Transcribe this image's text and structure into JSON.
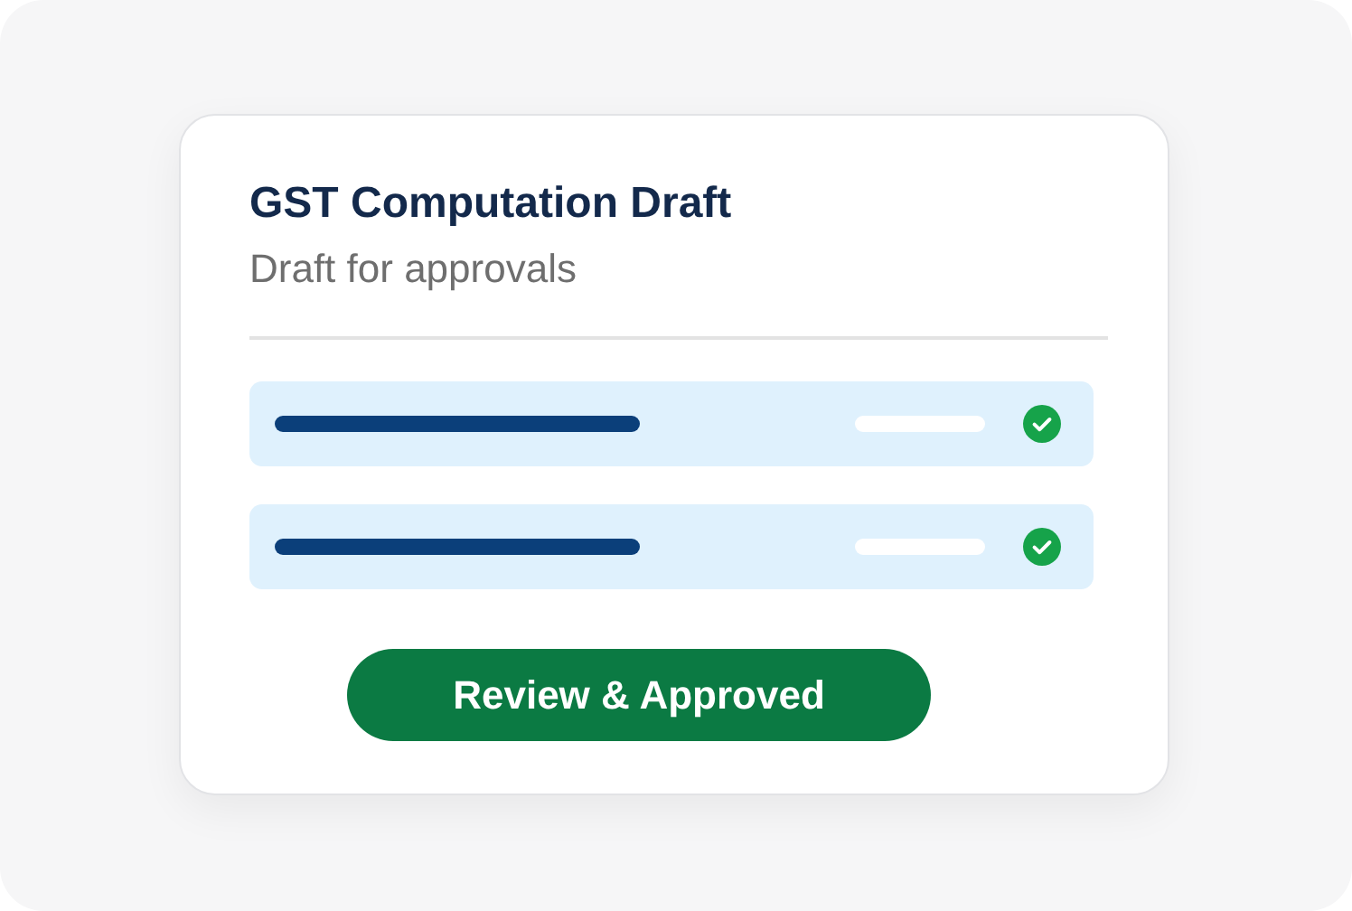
{
  "card": {
    "title": "GST Computation Draft",
    "subtitle": "Draft for approvals"
  },
  "rows": [
    {
      "checked": true
    },
    {
      "checked": true
    }
  ],
  "button": {
    "label": "Review & Approved"
  }
}
